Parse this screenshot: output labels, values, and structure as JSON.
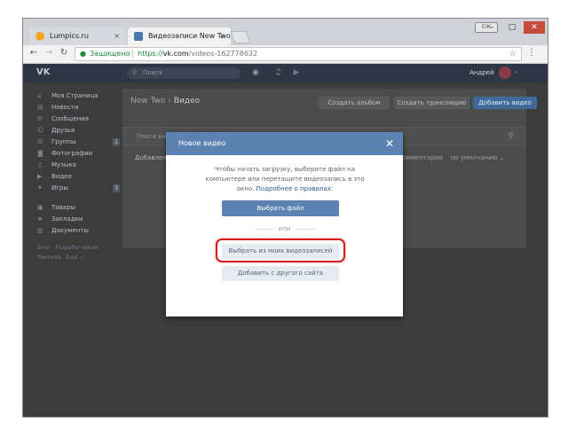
{
  "browser": {
    "tabs": [
      {
        "label": "Lumpics.ru",
        "close": "×",
        "favicon_color": "#f4a41e"
      },
      {
        "label": "Видеозаписи New Two",
        "close": "×",
        "favicon_color": "#4a76a8"
      }
    ],
    "profile_chip": "ЕЖ",
    "window_controls": {
      "minimize": "–",
      "maximize": "□",
      "close": "✕"
    },
    "nav": {
      "back": "←",
      "forward": "→",
      "reload": "↻"
    },
    "address": {
      "lock": "🔒",
      "secure_label": "Защищено",
      "scheme": "https://",
      "host": "vk.com",
      "path": "/videos-162778632",
      "star": "☆"
    },
    "menu": "⋮"
  },
  "vk": {
    "logo": "VK",
    "search_placeholder": "Поиск",
    "header_icons": [
      "bell-icon",
      "music-icon",
      "video-icon"
    ],
    "user_name": "Андрей",
    "sidebar": [
      {
        "label": "Моя Страница",
        "icon": "⌂"
      },
      {
        "label": "Новости",
        "icon": "▤"
      },
      {
        "label": "Сообщения",
        "icon": "✉"
      },
      {
        "label": "Друзья",
        "icon": "☺"
      },
      {
        "label": "Группы",
        "icon": "☰",
        "count": "1"
      },
      {
        "label": "Фотографии",
        "icon": "◙"
      },
      {
        "label": "Музыка",
        "icon": "♫"
      },
      {
        "label": "Видео",
        "icon": "▶"
      },
      {
        "label": "Игры",
        "icon": "✦",
        "count": "3"
      },
      {
        "label": "Товары",
        "icon": "▣"
      },
      {
        "label": "Закладки",
        "icon": "★"
      },
      {
        "label": "Документы",
        "icon": "▥"
      }
    ],
    "footer_links": [
      "Блог",
      "Разработчикам",
      "Реклама",
      "Ещё ⌄"
    ],
    "breadcrumb": {
      "group": "New Two",
      "sep": "›",
      "section": "Видео"
    },
    "actions": {
      "create_album": "Создать альбом",
      "create_stream": "Создать трансляцию",
      "add_video": "Добавить видео"
    },
    "search_placeholder_content": "Поиск ви",
    "tab_added": "Добавлен",
    "sort_by_comments": "ор комментарии",
    "sort_default": "по умолчанию ⌄"
  },
  "modal": {
    "title": "Новое видео",
    "close": "✕",
    "text": "Чтобы начать загрузку, выберите файл на компьютере или перетащите видеозапись в это окно.",
    "rules_link": "Подробнее о правилах",
    "select_file": "Выбрать файл",
    "or": "или",
    "select_mine": "Выбрать из моих видеозаписей",
    "add_from_site": "Добавить с другого сайта"
  },
  "colors": {
    "vk_blue": "#5b82b0",
    "highlight": "#d21f1f",
    "secure_green": "#1b8a3a"
  }
}
